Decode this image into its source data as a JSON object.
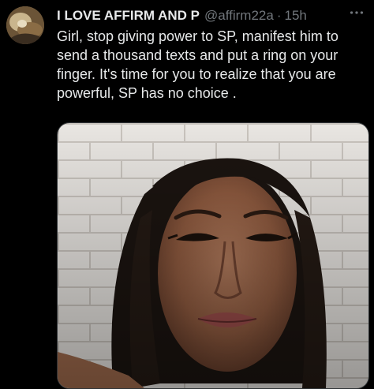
{
  "tweet": {
    "display_name": "I LOVE AFFIRM AND P",
    "handle": "@affirm22a",
    "separator": "·",
    "time": "15h",
    "more_icon": "more-horizontal-icon",
    "text": "Girl, stop giving power to SP, manifest him to send a thousand texts and put a ring on your finger. It's time for you to realize that you are powerful, SP has no choice .",
    "avatar_icon": "avatar-image",
    "media_description_icon": "photo-image"
  },
  "colors": {
    "background": "#000000",
    "primary_text": "#e7e9ea",
    "secondary_text": "#71767b",
    "border": "#2f3336"
  }
}
